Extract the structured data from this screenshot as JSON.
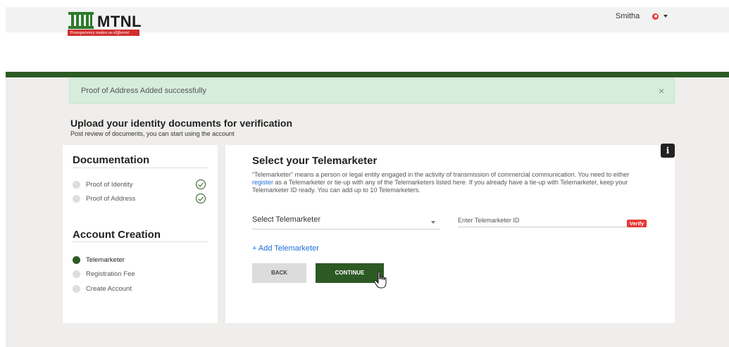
{
  "header": {
    "logo_text": "MTNL",
    "logo_tagline": "Transparency makes us different",
    "user_name": "Smitha"
  },
  "alert": {
    "message": "Proof of Address Added successfully",
    "close_label": "×"
  },
  "page": {
    "title": "Upload your identity documents for verification",
    "subtitle": "Post review of documents, you can start using the account"
  },
  "sidebar": {
    "documentation": {
      "title": "Documentation",
      "items": [
        {
          "label": "Proof of Identity",
          "done": true
        },
        {
          "label": "Proof of Address",
          "done": true
        }
      ]
    },
    "account_creation": {
      "title": "Account Creation",
      "items": [
        {
          "label": "Telemarketer",
          "active": true
        },
        {
          "label": "Registration Fee",
          "active": false
        },
        {
          "label": "Create Account",
          "active": false
        }
      ]
    }
  },
  "telemarketer": {
    "title": "Select your Telemarketer",
    "desc_before_link": "“Telemarketer” means a person or legal entity engaged in the activity of transmission of commercial communication. You need to either ",
    "desc_link": "register",
    "desc_after_link": " as a Telemarketer or tie-up with any of the Telemarketers listed here. If you already have a tie-up with Telemarketer, keep your Telemarketer ID ready. You can add up to 10 Telemarketers.",
    "info_icon_label": "i",
    "select_label": "Select Telemarketer",
    "id_placeholder": "Enter Telemarketer ID",
    "verify_label": "Verify",
    "add_label": "+ Add Telemarketer",
    "back_label": "BACK",
    "continue_label": "CONTINUE"
  },
  "colors": {
    "brand_green": "#2d5a24",
    "alert_bg": "#d6eddc",
    "verify_red": "#e53935",
    "link_blue": "#1e6fd9"
  },
  "icons": [
    "mtnl-logo-icon",
    "user-avatar-icon",
    "chevron-down-icon",
    "close-icon",
    "info-icon",
    "check-circle-icon",
    "hand-cursor-icon"
  ]
}
